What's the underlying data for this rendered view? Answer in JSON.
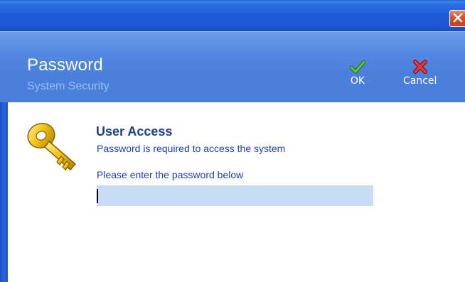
{
  "window": {
    "close_icon": "close-icon",
    "close_color": "#d9542c",
    "title_bar_color": "#1f5bd6"
  },
  "header": {
    "title": "Password",
    "subtitle": "System Security",
    "background_color": "#4a7fdc",
    "ok": {
      "label": "OK",
      "icon": "checkmark-icon",
      "color": "#3a9a1e"
    },
    "cancel": {
      "label": "Cancel",
      "icon": "x-icon",
      "color": "#d8262a"
    }
  },
  "main": {
    "icon": "key-icon",
    "section_title": "User Access",
    "section_description": "Password is required to access the system",
    "field_label": "Please enter the password below",
    "password_value": "",
    "input_background": "#c9dcf5"
  }
}
